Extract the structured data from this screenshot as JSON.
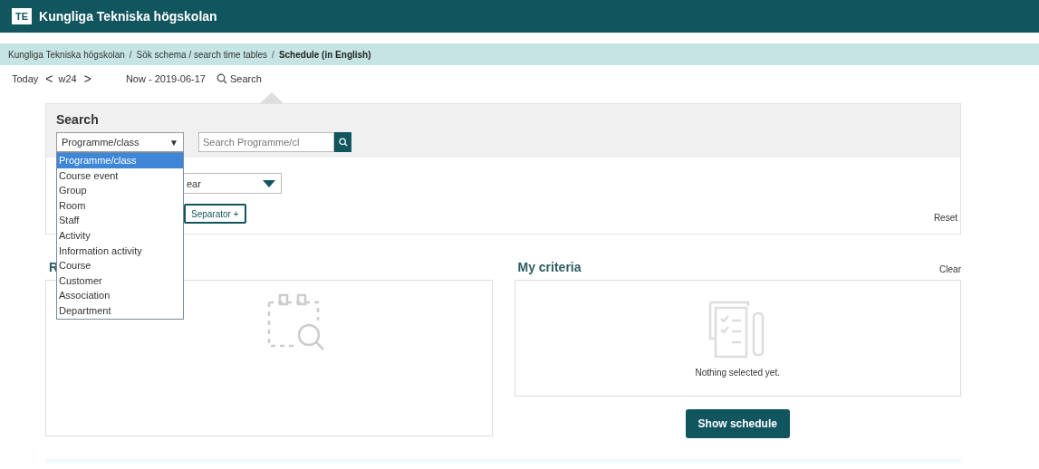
{
  "header": {
    "logo": "TE",
    "title": "Kungliga Tekniska högskolan"
  },
  "breadcrumb": [
    {
      "label": "Kungliga Tekniska högskolan",
      "current": false
    },
    {
      "separator": "/",
      "label": "Sök schema / search time tables",
      "current": false
    },
    {
      "separator": "/",
      "label": "Schedule (in English)",
      "current": true
    }
  ],
  "toolbar": {
    "today": "Today",
    "prev": "<",
    "week": "w24",
    "next": ">",
    "now": "Now - 2019-06-17",
    "search": "Search"
  },
  "search": {
    "title": "Search",
    "type_select": {
      "value": "Programme/class",
      "caret": "▼",
      "expanded": true,
      "options": [
        {
          "label": "Programme/class",
          "selected": true
        },
        {
          "label": "Course event",
          "selected": false
        },
        {
          "label": "Group",
          "selected": false
        },
        {
          "label": "Room",
          "selected": false
        },
        {
          "label": "Staff",
          "selected": false
        },
        {
          "label": "Activity",
          "selected": false
        },
        {
          "label": "Information activity",
          "selected": false
        },
        {
          "label": "Course",
          "selected": false
        },
        {
          "label": "Customer",
          "selected": false
        },
        {
          "label": "Association",
          "selected": false
        },
        {
          "label": "Department",
          "selected": false
        }
      ]
    },
    "query": {
      "placeholder": "Search Programme/cl"
    },
    "period_select": {
      "value": "ear"
    },
    "separator_button": "Separator +",
    "reset": "Reset"
  },
  "results": {
    "title": "R"
  },
  "criteria": {
    "title": "My criteria",
    "clear": "Clear",
    "empty": "Nothing selected yet.",
    "button": "Show schedule"
  }
}
